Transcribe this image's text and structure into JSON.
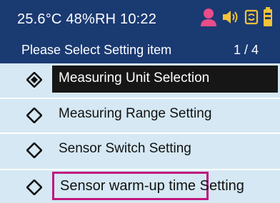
{
  "status_bar": {
    "temperature": "25.6°C",
    "humidity": "48%RH",
    "time": "10:22",
    "icons": [
      "user-icon",
      "speaker-icon",
      "sync-icon",
      "battery-icon"
    ],
    "colors": {
      "user": "#e84c8a",
      "speaker": "#f2c23a",
      "sync": "#f2c23a",
      "battery": "#f2c23a"
    }
  },
  "header": {
    "title": "Please Select  Setting item",
    "page": "1 / 4"
  },
  "menu": {
    "items": [
      {
        "label": "Measuring  Unit Selection",
        "selected": true
      },
      {
        "label": "Measuring Range Setting",
        "selected": false
      },
      {
        "label": "Sensor Switch Setting",
        "selected": false
      },
      {
        "label": "Sensor warm-up time Setting",
        "selected": false,
        "highlight": "Sensor warm-up time"
      }
    ]
  },
  "theme": {
    "header_bg": "#1a3a72",
    "list_bg": "#d5e8f3",
    "selected_bg": "#161616",
    "highlight_border": "#c0177f"
  }
}
